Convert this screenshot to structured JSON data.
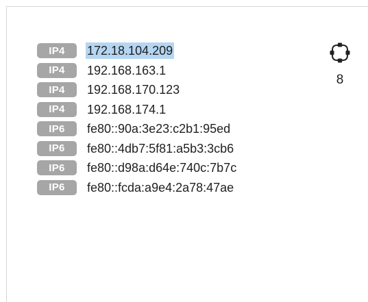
{
  "addresses": [
    {
      "type": "IP4",
      "address": "172.18.104.209",
      "selected": true
    },
    {
      "type": "IP4",
      "address": "192.168.163.1"
    },
    {
      "type": "IP4",
      "address": "192.168.170.123"
    },
    {
      "type": "IP4",
      "address": "192.168.174.1"
    },
    {
      "type": "IP6",
      "address": "fe80::90a:3e23:c2b1:95ed"
    },
    {
      "type": "IP6",
      "address": "fe80::4db7:5f81:a5b3:3cb6"
    },
    {
      "type": "IP6",
      "address": "fe80::d98a:d64e:740c:7b7c"
    },
    {
      "type": "IP6",
      "address": "fe80::fcda:a9e4:2a78:47ae"
    }
  ],
  "summary": {
    "icon": "network-icon",
    "count": "8"
  },
  "colors": {
    "badge": "#a6a6a6",
    "selection": "#b5d6f2",
    "text": "#1f1f1f"
  }
}
